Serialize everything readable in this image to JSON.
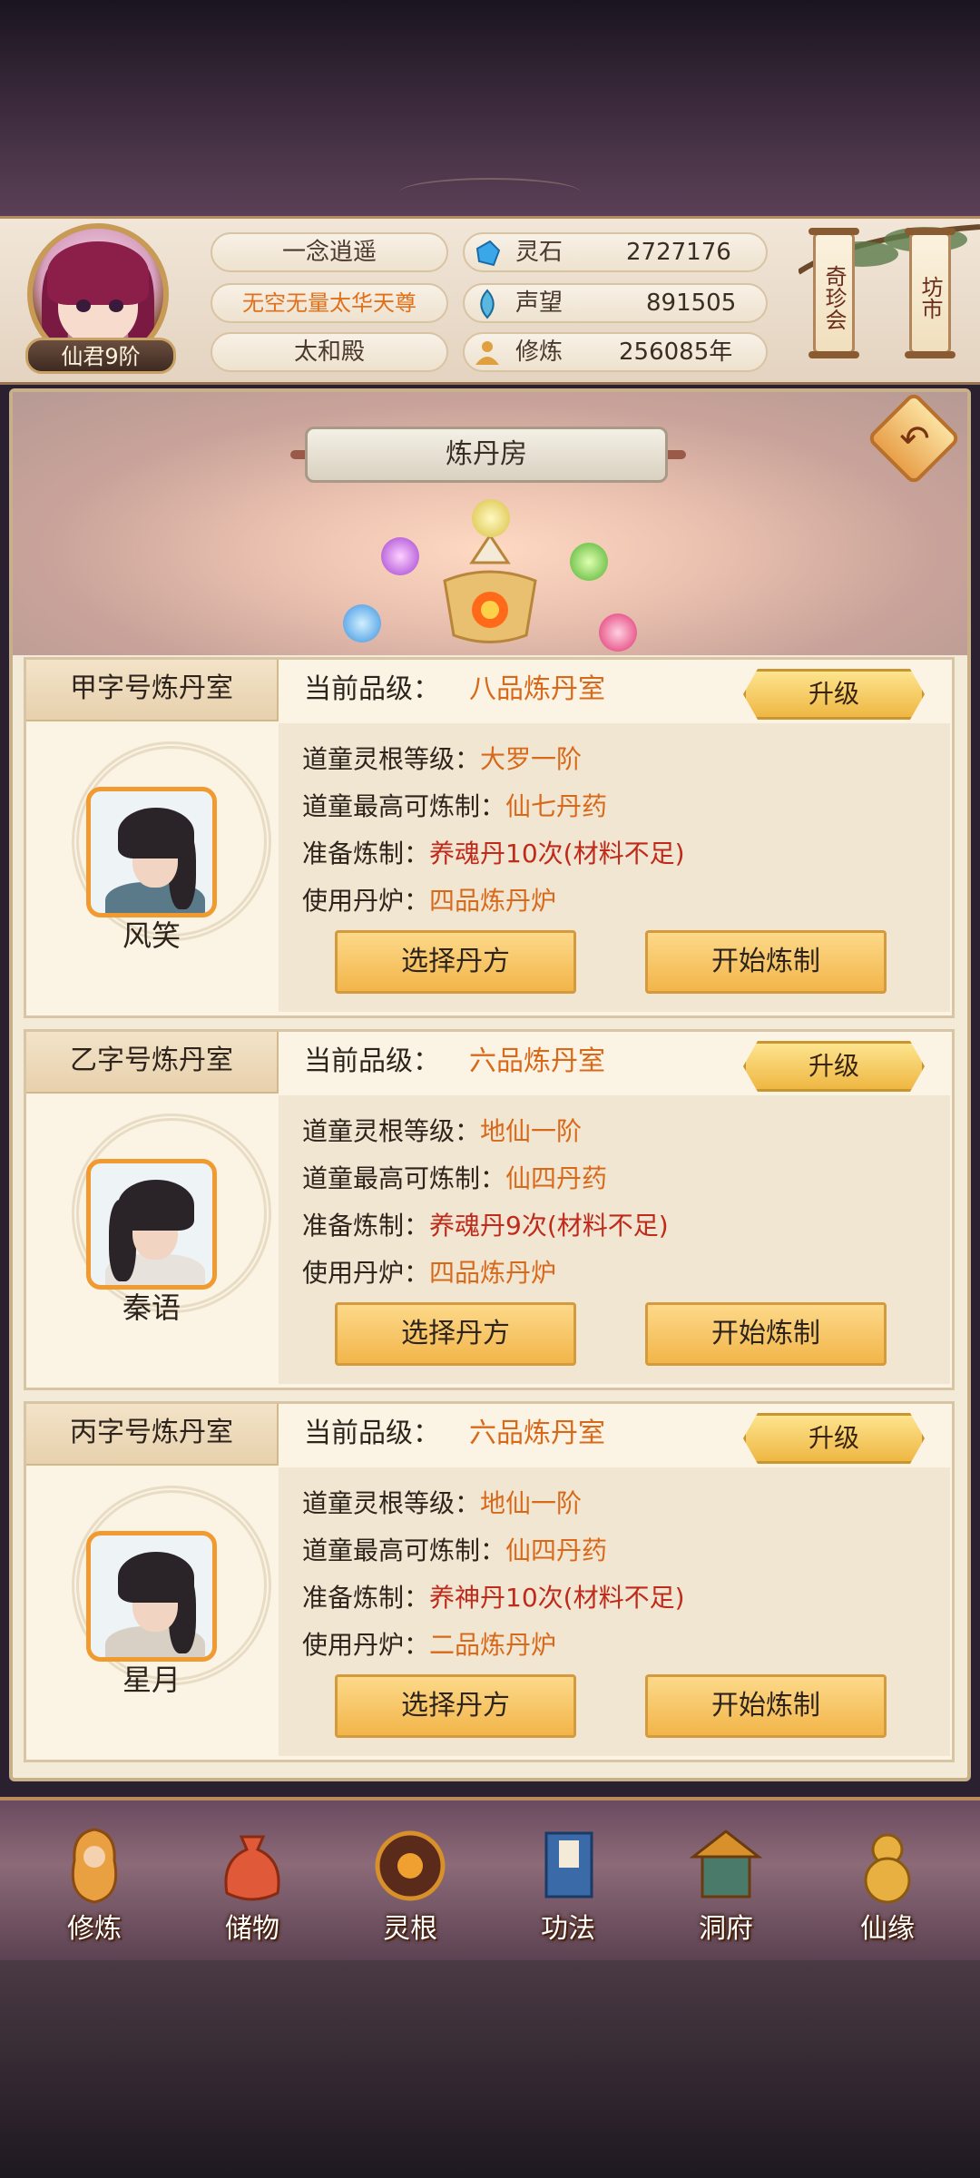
{
  "player": {
    "rank": "仙君9阶",
    "name": "一念逍遥",
    "title": "无空无量太华天尊",
    "location": "太和殿"
  },
  "resources": [
    {
      "icon": "spirit-stone-icon",
      "label": "灵石",
      "value": "2727176"
    },
    {
      "icon": "prestige-icon",
      "label": "声望",
      "value": "891505"
    },
    {
      "icon": "cultivation-icon",
      "label": "修炼",
      "value": "256085年"
    }
  ],
  "side_buttons": {
    "treasure": "奇珍会",
    "market": "坊市"
  },
  "page_title": "炼丹房",
  "labels": {
    "current_level": "当前品级：",
    "upgrade": "升级",
    "root_level": "道童灵根等级：",
    "max_refine": "道童最高可炼制：",
    "preparing": "准备炼制：",
    "furnace": "使用丹炉：",
    "select_recipe": "选择丹方",
    "start_refine": "开始炼制"
  },
  "rooms": [
    {
      "name": "甲字号炼丹室",
      "level": "八品炼丹室",
      "root": "大罗一阶",
      "max": "仙七丹药",
      "preparing": "养魂丹10次(材料不足)",
      "furnace": "四品炼丹炉",
      "attendant": "风笑"
    },
    {
      "name": "乙字号炼丹室",
      "level": "六品炼丹室",
      "root": "地仙一阶",
      "max": "仙四丹药",
      "preparing": "养魂丹9次(材料不足)",
      "furnace": "四品炼丹炉",
      "attendant": "秦语"
    },
    {
      "name": "丙字号炼丹室",
      "level": "六品炼丹室",
      "root": "地仙一阶",
      "max": "仙四丹药",
      "preparing": "养神丹10次(材料不足)",
      "furnace": "二品炼丹炉",
      "attendant": "星月"
    }
  ],
  "nav": [
    {
      "label": "修炼",
      "icon": "monk-icon"
    },
    {
      "label": "储物",
      "icon": "bag-icon"
    },
    {
      "label": "灵根",
      "icon": "spirit-root-icon"
    },
    {
      "label": "功法",
      "icon": "book-icon"
    },
    {
      "label": "洞府",
      "icon": "palace-icon"
    },
    {
      "label": "仙缘",
      "icon": "gourd-icon"
    }
  ],
  "colors": {
    "accent": "#d9691a",
    "warning": "#c02a1a",
    "button_gold": "#f2b54a"
  }
}
